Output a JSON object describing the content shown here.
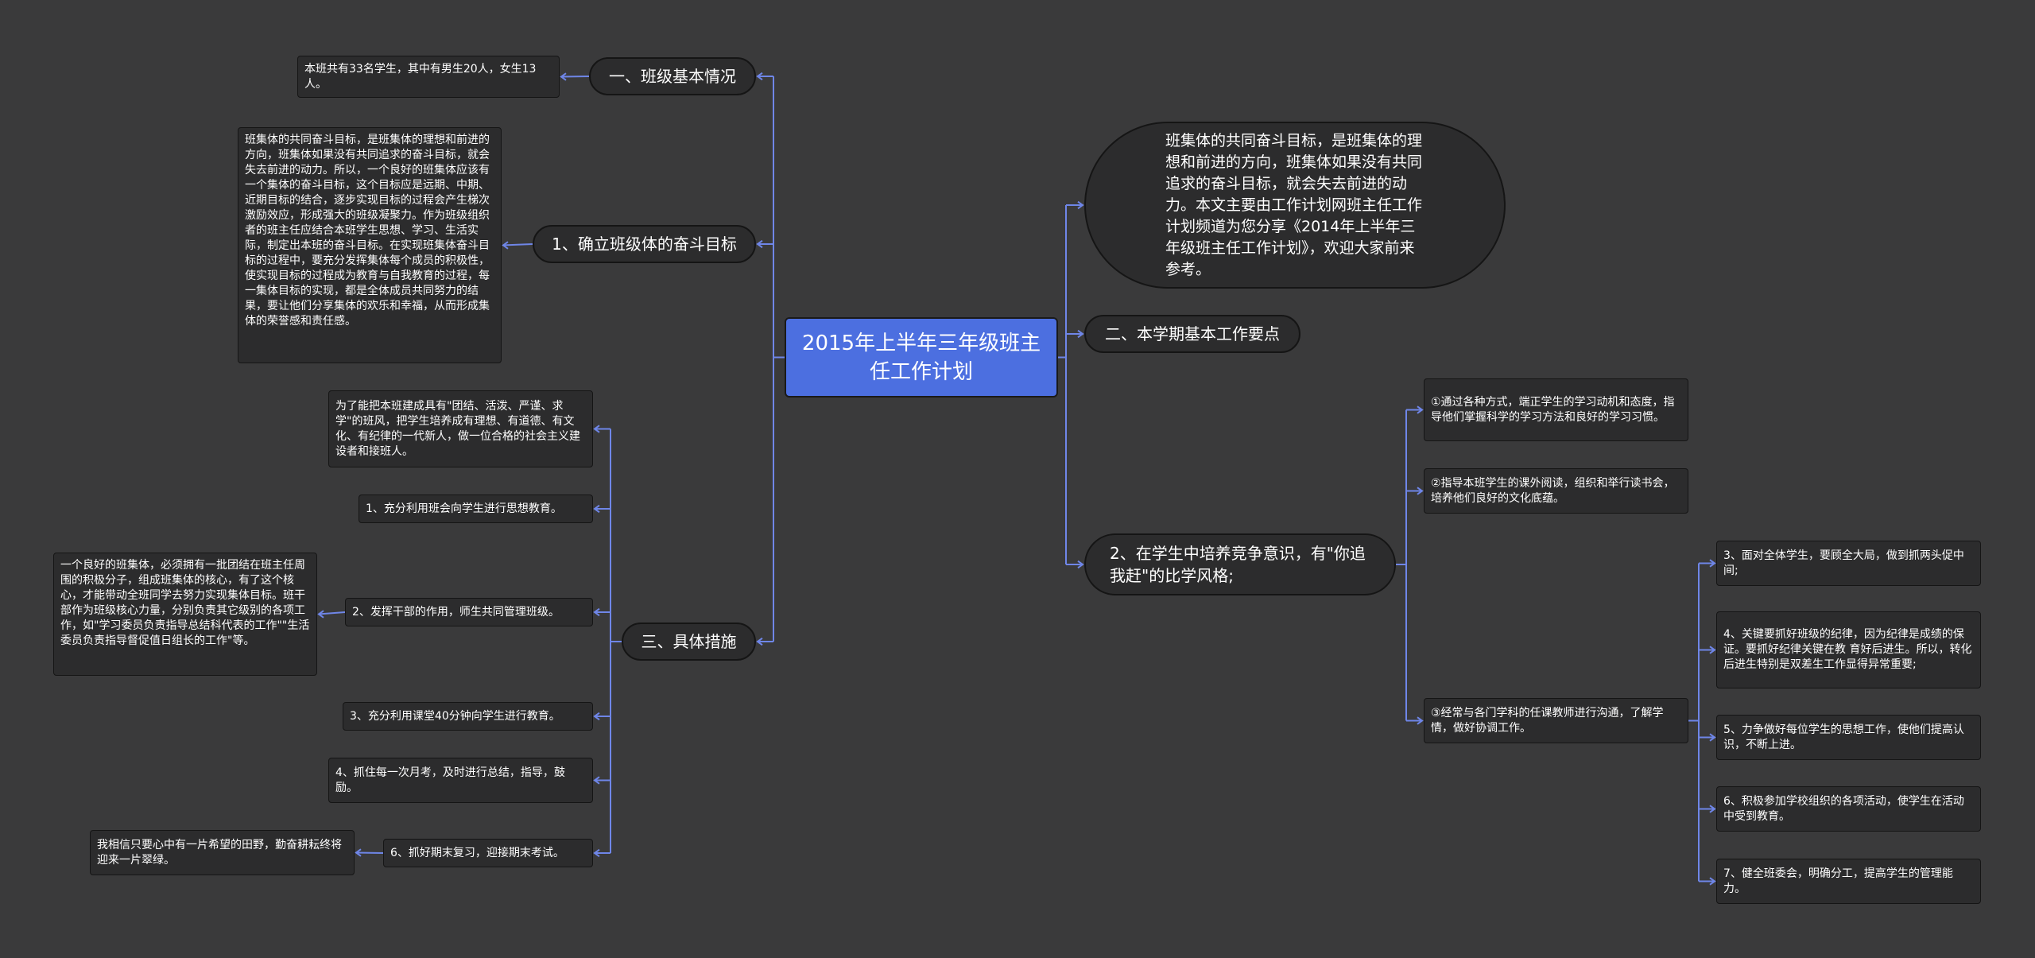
{
  "root": {
    "title": "2015年上半年三年级班主任工作计划"
  },
  "left": {
    "s1": {
      "label": "一、班级基本情况",
      "detail": "本班共有33名学生，其中有男生20人，女生13人。"
    },
    "s2": {
      "label": "1、确立班级体的奋斗目标",
      "detail": "班集体的共同奋斗目标，是班集体的理想和前进的方向，班集体如果没有共同追求的奋斗目标，就会失去前进的动力。所以，一个良好的班集体应该有一个集体的奋斗目标，这个目标应是远期、中期、近期目标的结合，逐步实现目标的过程会产生梯次激励效应，形成强大的班级凝聚力。作为班级组织者的班主任应结合本班学生思想、学习、生活实际，制定出本班的奋斗目标。在实现班集体奋斗目标的过程中，要充分发挥集体每个成员的积极性，使实现目标的过程成为教育与自我教育的过程，每一集体目标的实现，都是全体成员共同努力的结果，要让他们分享集体的欢乐和幸福，从而形成集体的荣誉感和责任感。"
    },
    "s3": {
      "label": "三、具体措施",
      "items": [
        {
          "label": "为了能把本班建成具有\"团结、活泼、严谨、求学\"的班风，把学生培养成有理想、有道德、有文化、有纪律的一代新人，做一位合格的社会主义建设者和接班人。"
        },
        {
          "label": "1、充分利用班会向学生进行思想教育。"
        },
        {
          "label": "2、发挥干部的作用，师生共同管理班级。",
          "detail": "一个良好的班集体，必须拥有一批团结在班主任周围的积极分子，组成班集体的核心，有了这个核心，才能带动全班同学去努力实现集体目标。班干部作为班级核心力量，分别负责其它级别的各项工作，如\"学习委员负责指导总结科代表的工作\"\"生活委员负责指导督促值日组长的工作\"等。"
        },
        {
          "label": "3、充分利用课堂40分钟向学生进行教育。"
        },
        {
          "label": "4、抓住每一次月考，及时进行总结，指导，鼓励。"
        },
        {
          "label": "6、抓好期末复习，迎接期末考试。",
          "detail": "我相信只要心中有一片希望的田野，勤奋耕耘终将迎来一片翠绿。"
        }
      ]
    }
  },
  "right": {
    "intro": "班集体的共同奋斗目标，是班集体的理想和前进的方向，班集体如果没有共同追求的奋斗目标，就会失去前进的动力。本文主要由工作计划网班主任工作计划频道为您分享《2014年上半年三年级班主任工作计划》，欢迎大家前来参考。",
    "s2": {
      "label": "二、本学期基本工作要点"
    },
    "s3": {
      "label": "2、在学生中培养竞争意识，有\"你追我赶\"的比学风格;",
      "items": [
        {
          "label": "①通过各种方式，端正学生的学习动机和态度，指导他们掌握科学的学习方法和良好的学习习惯。"
        },
        {
          "label": "②指导本班学生的课外阅读，组织和举行读书会，培养他们良好的文化底蕴。"
        },
        {
          "label": "③经常与各门学科的任课教师进行沟通，了解学情，做好协调工作。",
          "items": [
            {
              "label": "3、面对全体学生，要顾全大局，做到抓两头促中间;"
            },
            {
              "label": "4、关键要抓好班级的纪律，因为纪律是成绩的保证。要抓好纪律关键在教 育好后进生。所以，转化后进生特别是双差生工作显得异常重要;"
            },
            {
              "label": "5、力争做好每位学生的思想工作，使他们提高认识，不断上进。"
            },
            {
              "label": "6、积极参加学校组织的各项活动，使学生在活动中受到教育。"
            },
            {
              "label": "7、健全班委会，明确分工，提高学生的管理能力。"
            }
          ]
        }
      ]
    }
  },
  "colors": {
    "background": "#3a3a3b",
    "root": "#4c6fe0",
    "connector": "#6f86e8",
    "node": "#2c2c2d"
  }
}
